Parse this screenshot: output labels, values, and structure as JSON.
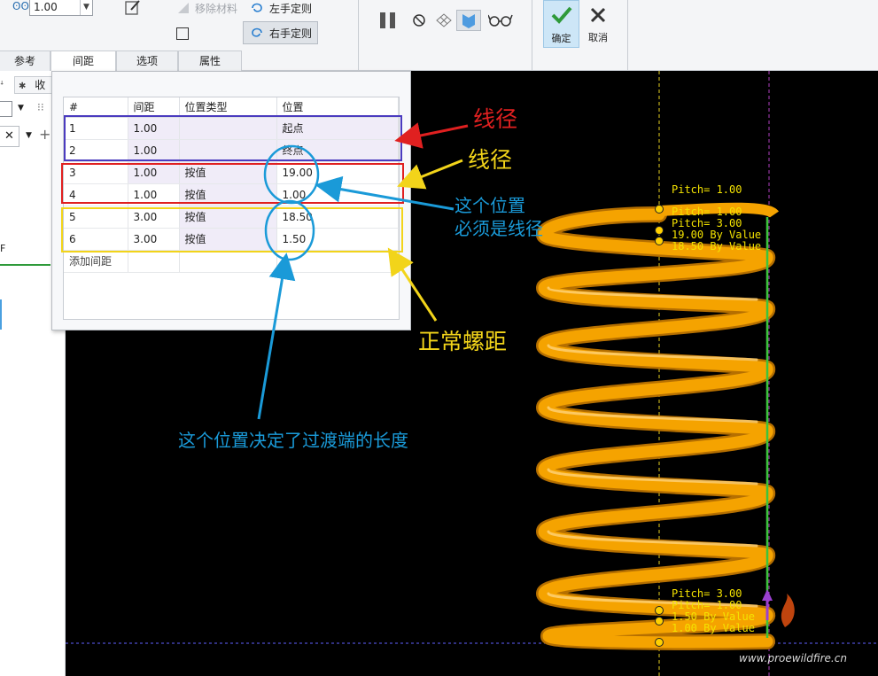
{
  "ribbon": {
    "pitch_value": "1.00",
    "remove_material": "移除材料",
    "left_handed": "左手定则",
    "right_handed": "右手定则",
    "ok": "确定",
    "cancel": "取消"
  },
  "tabs": [
    "参考",
    "间距",
    "选项",
    "属性"
  ],
  "left_panel": {
    "favorites_tab": "收",
    "field_letter": "F"
  },
  "table": {
    "headers": [
      "#",
      "间距",
      "位置类型",
      "位置"
    ],
    "rows": [
      {
        "idx": "1",
        "pitch": "1.00",
        "type": "",
        "pos": "起点"
      },
      {
        "idx": "2",
        "pitch": "1.00",
        "type": "",
        "pos": "终点"
      },
      {
        "idx": "3",
        "pitch": "1.00",
        "type": "按值",
        "pos": "19.00"
      },
      {
        "idx": "4",
        "pitch": "1.00",
        "type": "按值",
        "pos": "1.00"
      },
      {
        "idx": "5",
        "pitch": "3.00",
        "type": "按值",
        "pos": "18.50"
      },
      {
        "idx": "6",
        "pitch": "3.00",
        "type": "按值",
        "pos": "1.50"
      }
    ],
    "add_row": "添加间距"
  },
  "annotations": {
    "red_label": "线径",
    "yellow_label": "线径",
    "blue_note_1": "这个位置",
    "blue_note_2": "必须是线径",
    "normal_pitch": "正常螺距",
    "transition_note": "这个位置决定了过渡端的长度"
  },
  "viewport_labels": {
    "top": [
      "Pitch= 1.00",
      "Pitch= 1.00",
      "Pitch= 3.00",
      "19.00 By Value",
      "18.50 By Value"
    ],
    "bottom": [
      "Pitch= 3.00",
      "Pitch= 1.00",
      "1.50 By Value",
      "1.00 By Value"
    ],
    "watermark_url": "www.proewildfire.cn"
  },
  "colors": {
    "spring": "#f5a300",
    "annot_red": "#e02020",
    "annot_yellow": "#f2d41a",
    "annot_blue": "#1a9ad8",
    "box_purple": "#4b3bbf",
    "label_yellow": "#f4e300",
    "axis_green": "#3cc43c"
  }
}
